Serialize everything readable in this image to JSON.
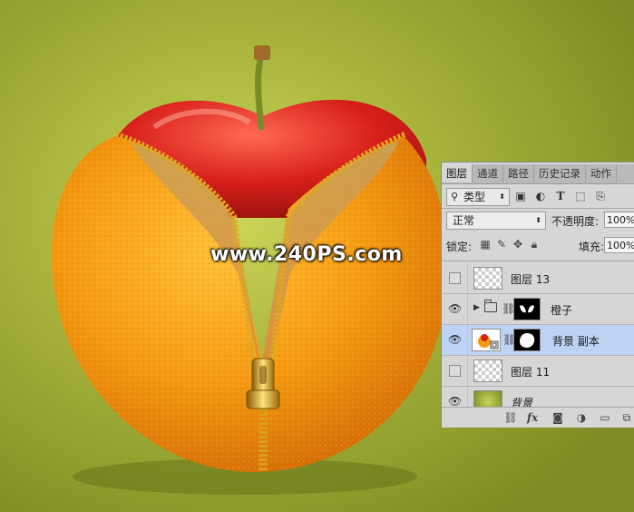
{
  "watermark": "www.240PS.com",
  "panel": {
    "tabs": [
      {
        "label": "图层",
        "active": true
      },
      {
        "label": "通道",
        "active": false
      },
      {
        "label": "路径",
        "active": false
      },
      {
        "label": "历史记录",
        "active": false
      },
      {
        "label": "动作",
        "active": false
      }
    ],
    "filter": {
      "label": "类型",
      "icon": "search-icon"
    },
    "filter_icons": [
      "image-filter-icon",
      "adjustment-filter-icon",
      "type-filter-icon",
      "shape-filter-icon",
      "smart-object-filter-icon"
    ],
    "blend_mode": "正常",
    "opacity_label": "不透明度:",
    "opacity_value": "100%",
    "lock_label": "锁定:",
    "lock_icons": [
      "lock-transparent-icon",
      "lock-paint-icon",
      "lock-move-icon",
      "lock-all-icon"
    ],
    "fill_label": "填充:",
    "fill_value": "100%",
    "layers": [
      {
        "name": "图层 13",
        "visible": false,
        "type": "pixel"
      },
      {
        "name": "橙子",
        "visible": true,
        "type": "group"
      },
      {
        "name": "背景 副本",
        "visible": true,
        "type": "smart",
        "selected": true
      },
      {
        "name": "图层 11",
        "visible": false,
        "type": "pixel"
      },
      {
        "name": "背景",
        "visible": true,
        "type": "background"
      }
    ],
    "bottom_icons": [
      "link-layers-icon",
      "fx-icon",
      "add-mask-icon",
      "adjustment-layer-icon",
      "new-group-icon",
      "new-layer-icon"
    ]
  },
  "colors": {
    "background_light": "#cdd65a",
    "background_dark": "#7e8a22",
    "orange": "#f59a10",
    "apple_red": "#d81f1a",
    "zipper_gold": "#d9a21c",
    "selected_row": "#bcd3f3",
    "panel_bg": "#d6d6d6"
  }
}
